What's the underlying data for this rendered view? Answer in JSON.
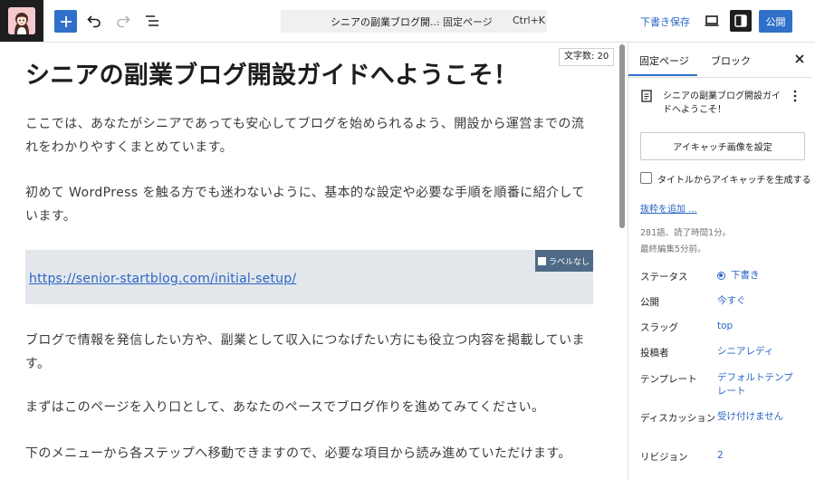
{
  "toolbar": {
    "command_title": "シニアの副業ブログ開...",
    "command_type": "· 固定ページ",
    "command_shortcut": "Ctrl+K",
    "save_draft": "下書き保存",
    "publish": "公開"
  },
  "editor": {
    "word_count": "文字数: 20",
    "title": "シニアの副業ブログ開設ガイドへようこそ！",
    "paragraphs": [
      "ここでは、あなたがシニアであっても安心してブログを始められるよう、開設から運営までの流れをわかりやすくまとめています。",
      "初めて WordPress を触る方でも迷わないように、基本的な設定や必要な手順を順番に紹介しています。",
      "ブログで情報を発信したい方や、副業として収入につなげたい方にも役立つ内容を掲載しています。",
      "まずはこのページを入り口として、あなたのペースでブログ作りを進めてみてください。",
      "下のメニューから各ステップへ移動できますので、必要な項目から読み進めていただけます。"
    ],
    "embed_url": "https://senior-startblog.com/initial-setup/",
    "embed_label_toggle": "ラベルなし"
  },
  "sidebar": {
    "tabs": [
      "固定ページ",
      "ブロック"
    ],
    "doc_title": "シニアの副業ブログ開設ガイドへようこそ！",
    "featured_image_button": "アイキャッチ画像を設定",
    "generate_from_title": "タイトルからアイキャッチを生成する",
    "add_excerpt": "抜粋を追加 ...",
    "stats": "281語、読了時間1分。",
    "last_edited": "最終編集5分前。",
    "rows": [
      {
        "label": "ステータス",
        "value": "下書き"
      },
      {
        "label": "公開",
        "value": "今すぐ"
      },
      {
        "label": "スラッグ",
        "value": "top"
      },
      {
        "label": "投稿者",
        "value": "シニアレディ"
      },
      {
        "label": "テンプレート",
        "value": "デフォルトテンプレート"
      },
      {
        "label": "ディスカッション",
        "value": "受け付けません"
      },
      {
        "label": "リビジョン",
        "value": "2"
      }
    ]
  },
  "colors": {
    "accent": "#3070c8",
    "link": "#2b66c4",
    "embed_background": "#e3e7eb"
  }
}
